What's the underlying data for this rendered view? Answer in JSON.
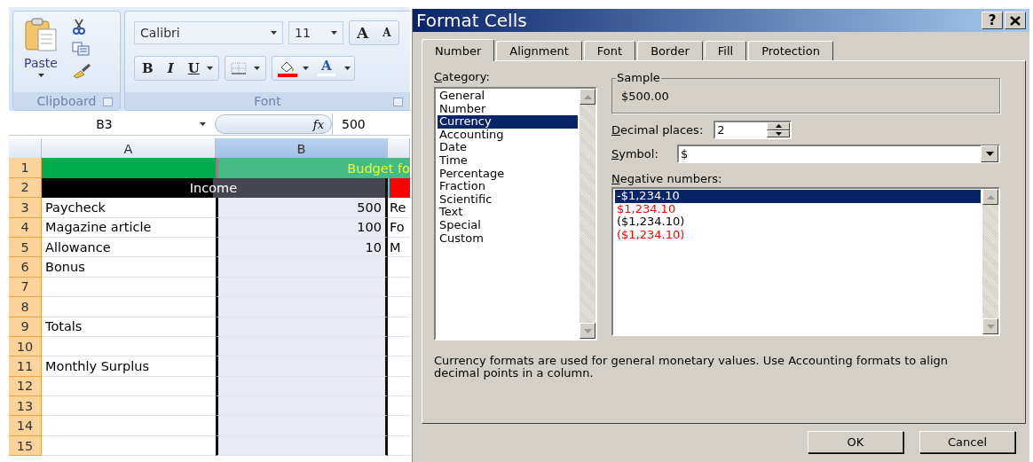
{
  "ribbon": {
    "clipboard": {
      "paste": "Paste",
      "group_label": "Clipboard"
    },
    "font": {
      "font_name": "Calibri",
      "font_size": "11",
      "grow": "A",
      "shrink": "A",
      "bold": "B",
      "italic": "I",
      "underline": "U",
      "font_color": "A",
      "group_label": "Font"
    }
  },
  "formula_bar": {
    "name_box": "B3",
    "fx": "fx",
    "value": "500"
  },
  "sheet": {
    "columns": [
      {
        "label": "A",
        "selected": false
      },
      {
        "label": "B",
        "selected": true
      }
    ],
    "row_1": {
      "number": "1",
      "title": "Budget fo"
    },
    "row_2": {
      "number": "2",
      "heading": "Income"
    },
    "rows": [
      {
        "number": "3",
        "a": "Paycheck",
        "b": "500",
        "c": "Re"
      },
      {
        "number": "4",
        "a": "Magazine article",
        "b": "100",
        "c": "Fo"
      },
      {
        "number": "5",
        "a": "Allowance",
        "b": "10",
        "c": "M"
      },
      {
        "number": "6",
        "a": "Bonus"
      },
      {
        "number": "7"
      },
      {
        "number": "8"
      },
      {
        "number": "9",
        "a": "Totals"
      },
      {
        "number": "10"
      },
      {
        "number": "11",
        "a": "Monthly Surplus"
      },
      {
        "number": "12"
      },
      {
        "number": "13"
      },
      {
        "number": "14"
      },
      {
        "number": "15"
      }
    ]
  },
  "dialog": {
    "title": "Format Cells",
    "help": "?",
    "tabs": [
      {
        "label": "Number",
        "selected": true
      },
      {
        "label": "Alignment",
        "selected": false
      },
      {
        "label": "Font",
        "selected": false
      },
      {
        "label": "Border",
        "selected": false
      },
      {
        "label": "Fill",
        "selected": false
      },
      {
        "label": "Protection",
        "selected": false
      }
    ],
    "category": {
      "label": "Category:",
      "items": [
        {
          "label": "General",
          "selected": false
        },
        {
          "label": "Number",
          "selected": false
        },
        {
          "label": "Currency",
          "selected": true
        },
        {
          "label": "Accounting",
          "selected": false
        },
        {
          "label": "Date",
          "selected": false
        },
        {
          "label": "Time",
          "selected": false
        },
        {
          "label": "Percentage",
          "selected": false
        },
        {
          "label": "Fraction",
          "selected": false
        },
        {
          "label": "Scientific",
          "selected": false
        },
        {
          "label": "Text",
          "selected": false
        },
        {
          "label": "Special",
          "selected": false
        },
        {
          "label": "Custom",
          "selected": false
        }
      ]
    },
    "sample": {
      "label": "Sample",
      "value": "$500.00"
    },
    "decimal_places": {
      "label": "Decimal places:",
      "value": "2"
    },
    "symbol": {
      "label": "Symbol:",
      "value": "$"
    },
    "negative_numbers": {
      "label": "Negative numbers:",
      "items": [
        {
          "label": "-$1,234.10",
          "selected": true
        },
        {
          "label": "$1,234.10",
          "selected": false,
          "color": "#ff0000"
        },
        {
          "label": "($1,234.10)",
          "selected": false,
          "color": "#000000"
        },
        {
          "label": "($1,234.10)",
          "selected": false,
          "color": "#ff0000"
        }
      ]
    },
    "description": "Currency formats are used for general monetary values.  Use Accounting formats to align decimal points in a column.",
    "buttons": [
      "OK",
      "Cancel"
    ]
  }
}
